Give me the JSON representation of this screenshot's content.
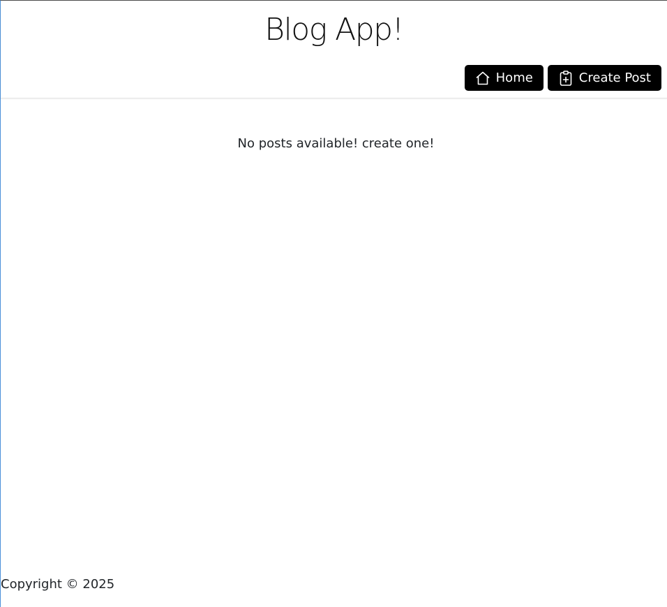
{
  "header": {
    "title": "Blog App!",
    "nav": [
      {
        "label": "Home",
        "icon": "home-icon"
      },
      {
        "label": "Create Post",
        "icon": "clipboard-plus-icon"
      }
    ]
  },
  "main": {
    "empty_message": "No posts available! create one!"
  },
  "footer": {
    "copyright": "Copyright © 2025"
  },
  "colors": {
    "nav_button_bg": "#000000",
    "nav_button_text": "#ffffff",
    "text": "#212529"
  }
}
